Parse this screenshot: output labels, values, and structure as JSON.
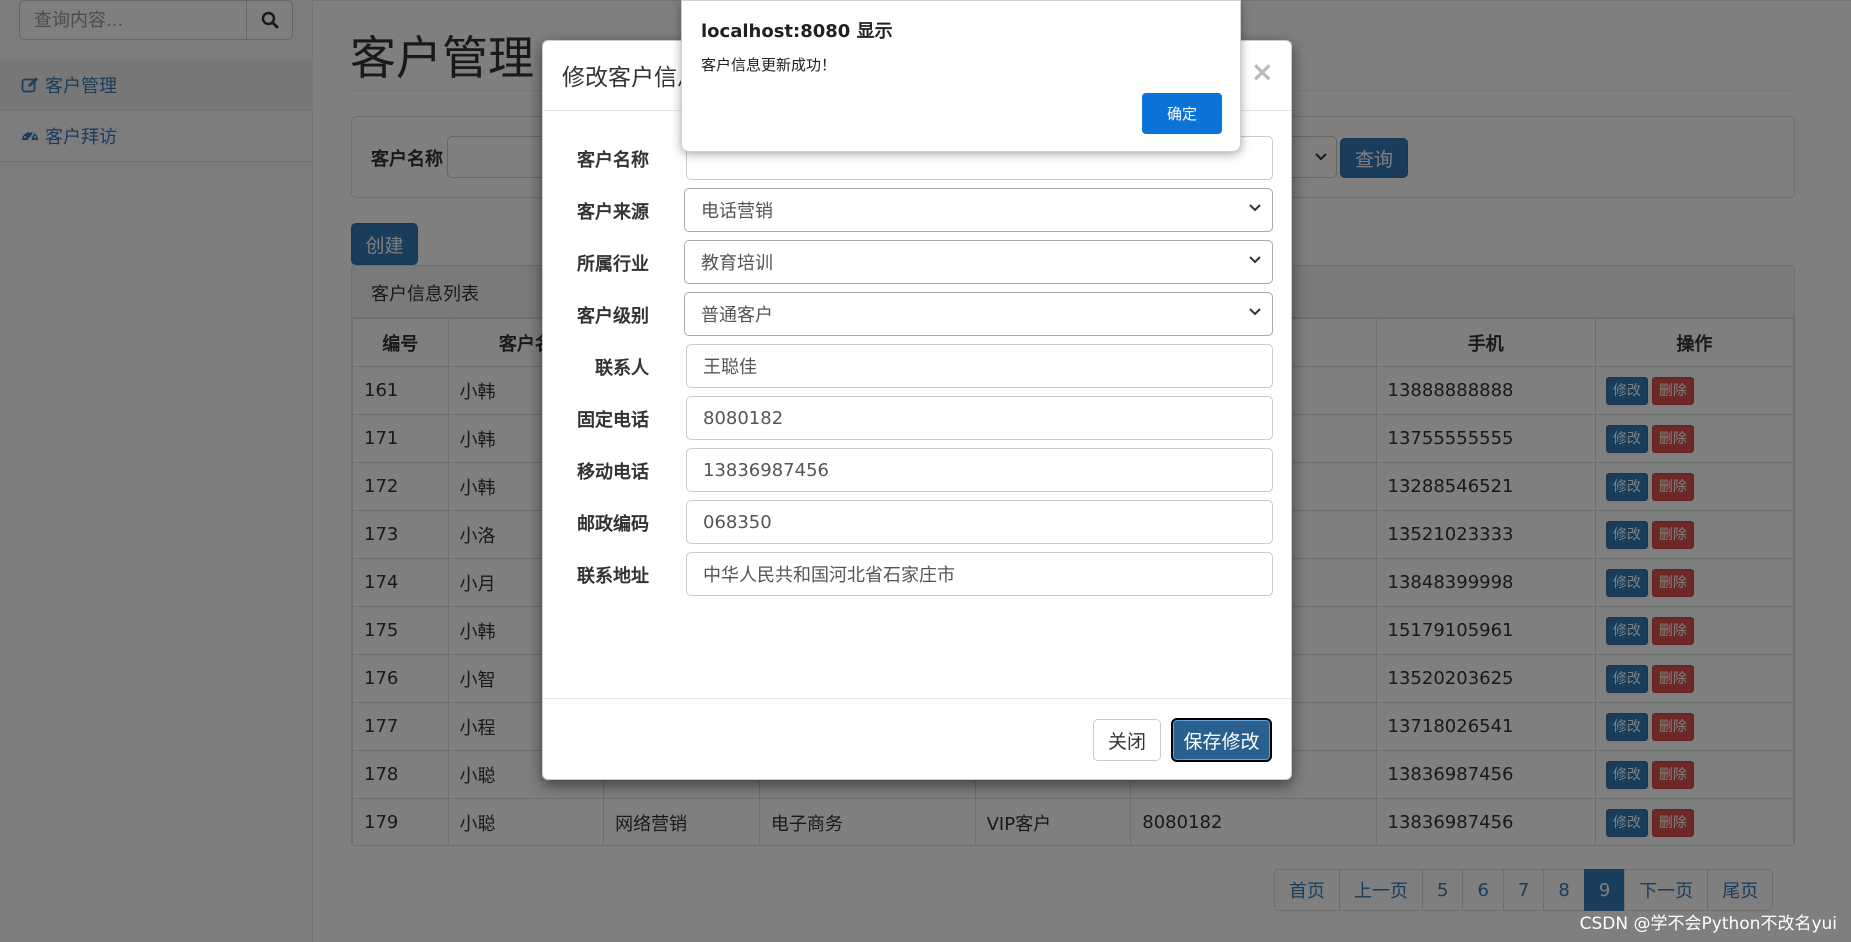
{
  "sidebar": {
    "search_placeholder": "查询内容...",
    "items": [
      {
        "label": "客户管理",
        "icon": "edit-icon"
      },
      {
        "label": "客户拜访",
        "icon": "dashboard-icon"
      }
    ]
  },
  "page": {
    "title": "客户管理",
    "filter_label": "客户名称",
    "query_label": "查询",
    "create_label": "创建",
    "list_heading": "客户信息列表"
  },
  "table": {
    "headers": [
      "编号",
      "客户名",
      "",
      "",
      "",
      "",
      "手机",
      "操作"
    ],
    "rows": [
      [
        "161",
        "小韩",
        "",
        "",
        "",
        "",
        "13888888888"
      ],
      [
        "171",
        "小韩",
        "",
        "",
        "",
        "",
        "13755555555"
      ],
      [
        "172",
        "小韩",
        "",
        "",
        "",
        "",
        "13288546521"
      ],
      [
        "173",
        "小洛",
        "",
        "",
        "",
        "",
        "13521023333"
      ],
      [
        "174",
        "小月",
        "",
        "",
        "",
        "",
        "13848399998"
      ],
      [
        "175",
        "小韩",
        "",
        "",
        "",
        "",
        "15179105961"
      ],
      [
        "176",
        "小智",
        "",
        "",
        "",
        "",
        "13520203625"
      ],
      [
        "177",
        "小程",
        "",
        "",
        "",
        "",
        "13718026541"
      ],
      [
        "178",
        "小聪",
        "",
        "",
        "",
        "",
        "13836987456"
      ],
      [
        "179",
        "小聪",
        "网络营销",
        "电子商务",
        "VIP客户",
        "8080182",
        "13836987456"
      ]
    ],
    "edit_label": "修改",
    "delete_label": "删除"
  },
  "pagination": [
    "首页",
    "上一页",
    "5",
    "6",
    "7",
    "8",
    "9",
    "下一页",
    "尾页"
  ],
  "pagination_active": "9",
  "modal": {
    "title": "修改客户信息",
    "close_symbol": "×",
    "fields": [
      {
        "label": "客户名称",
        "value": "",
        "type": "input"
      },
      {
        "label": "客户来源",
        "value": "电话营销",
        "type": "select"
      },
      {
        "label": "所属行业",
        "value": "教育培训",
        "type": "select"
      },
      {
        "label": "客户级别",
        "value": "普通客户",
        "type": "select"
      },
      {
        "label": "联系人",
        "value": "王聪佳",
        "type": "input"
      },
      {
        "label": "固定电话",
        "value": "8080182",
        "type": "input"
      },
      {
        "label": "移动电话",
        "value": "13836987456",
        "type": "input"
      },
      {
        "label": "邮政编码",
        "value": "068350",
        "type": "input"
      },
      {
        "label": "联系地址",
        "value": "中华人民共和国河北省石家庄市",
        "type": "input"
      }
    ],
    "close_label": "关闭",
    "save_label": "保存修改"
  },
  "alert": {
    "title": "localhost:8080 显示",
    "message": "客户信息更新成功！",
    "ok_label": "确定"
  },
  "watermark": "CSDN @学不会Python不改名yui",
  "colors": {
    "primary": "#337ab7",
    "danger": "#d9534f",
    "alert_button": "#0b72d8"
  }
}
